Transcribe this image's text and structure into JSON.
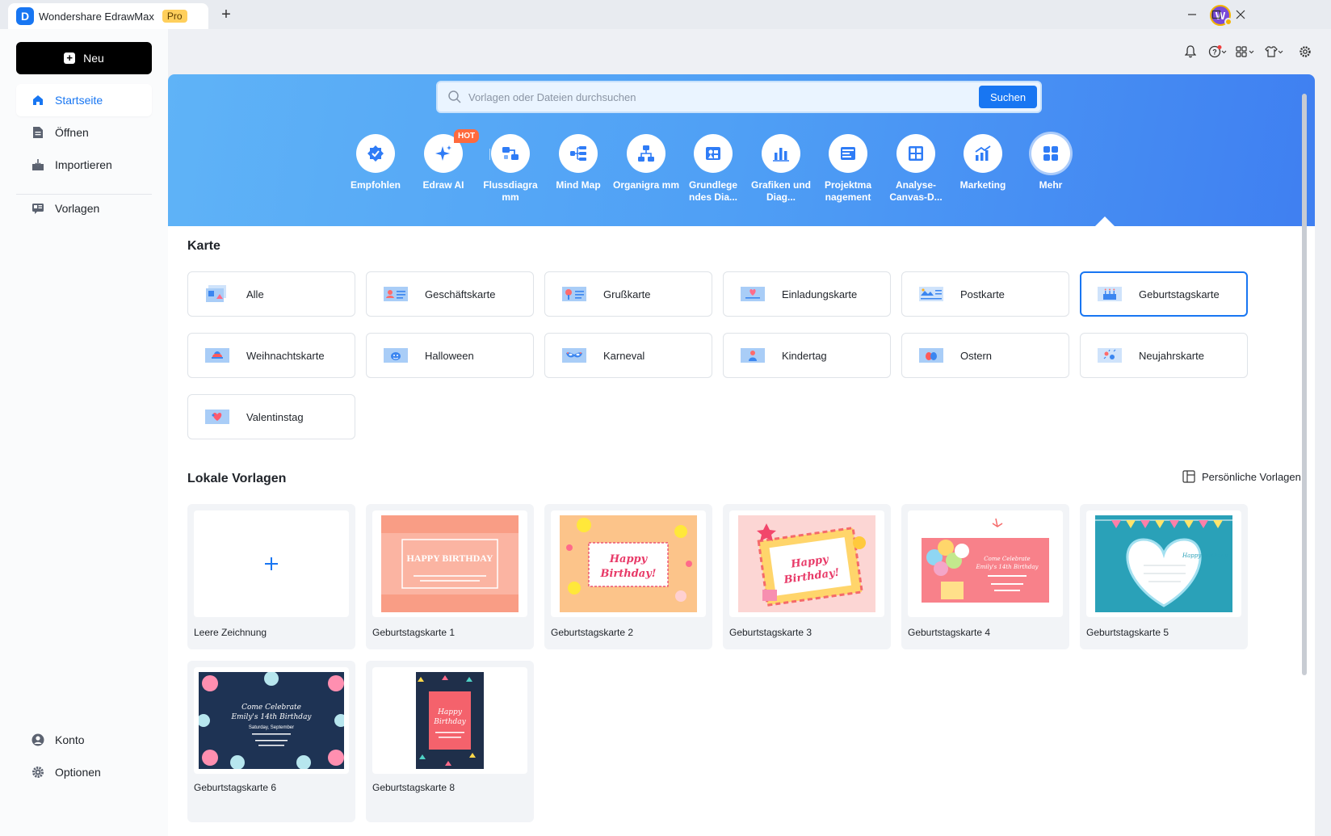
{
  "app": {
    "title": "Wondershare EdrawMax",
    "badge": "Pro",
    "avatar_initial": "W",
    "logo_letter": "D"
  },
  "sidebar": {
    "new_label": "Neu",
    "items": [
      {
        "label": "Startseite",
        "icon": "home-icon",
        "active": true
      },
      {
        "label": "Öffnen",
        "icon": "file-icon"
      },
      {
        "label": "Importieren",
        "icon": "import-icon"
      },
      {
        "label": "Vorlagen",
        "icon": "templates-icon"
      }
    ],
    "bottom_items": [
      {
        "label": "Konto",
        "icon": "account-icon"
      },
      {
        "label": "Optionen",
        "icon": "gear-icon"
      }
    ]
  },
  "search": {
    "placeholder": "Vorlagen oder Dateien durchsuchen",
    "button_label": "Suchen"
  },
  "categories": [
    {
      "label": "Empfohlen",
      "icon": "recommend-icon"
    },
    {
      "label": "Edraw AI",
      "icon": "ai-sparkle-icon",
      "badge": "HOT"
    },
    {
      "label": "Flussdiagra mm",
      "icon": "flowchart-icon"
    },
    {
      "label": "Mind Map",
      "icon": "mindmap-icon"
    },
    {
      "label": "Organigra mm",
      "icon": "orgchart-icon"
    },
    {
      "label": "Grundlege ndes Dia...",
      "icon": "basic-diagram-icon"
    },
    {
      "label": "Grafiken und Diag...",
      "icon": "chart-icon"
    },
    {
      "label": "Projektma nagement",
      "icon": "project-icon"
    },
    {
      "label": "Analyse- Canvas-D...",
      "icon": "canvas-icon"
    },
    {
      "label": "Marketing",
      "icon": "marketing-icon"
    },
    {
      "label": "Mehr",
      "icon": "more-grid-icon",
      "selected": true
    }
  ],
  "karte": {
    "title": "Karte",
    "types": [
      {
        "label": "Alle",
        "icon": "all-cards-icon"
      },
      {
        "label": "Geschäftskarte",
        "icon": "business-card-icon"
      },
      {
        "label": "Grußkarte",
        "icon": "greeting-card-icon"
      },
      {
        "label": "Einladungskarte",
        "icon": "invitation-card-icon"
      },
      {
        "label": "Postkarte",
        "icon": "postcard-icon"
      },
      {
        "label": "Geburtstagskarte",
        "icon": "birthday-card-icon",
        "selected": true
      },
      {
        "label": "Weihnachtskarte",
        "icon": "christmas-card-icon"
      },
      {
        "label": "Halloween",
        "icon": "halloween-card-icon"
      },
      {
        "label": "Karneval",
        "icon": "carnival-card-icon"
      },
      {
        "label": "Kindertag",
        "icon": "childrens-day-icon"
      },
      {
        "label": "Ostern",
        "icon": "easter-card-icon"
      },
      {
        "label": "Neujahrskarte",
        "icon": "new-year-card-icon"
      },
      {
        "label": "Valentinstag",
        "icon": "valentine-card-icon"
      }
    ]
  },
  "local": {
    "title": "Lokale Vorlagen",
    "personal_label": "Persönliche Vorlagen",
    "templates": [
      {
        "label": "Leere Zeichnung",
        "kind": "blank"
      },
      {
        "label": "Geburtstagskarte 1",
        "kind": "t1",
        "text": "HAPPY BIRTHDAY"
      },
      {
        "label": "Geburtstagskarte 2",
        "kind": "t2",
        "text": "Happy Birthday!"
      },
      {
        "label": "Geburtstagskarte 3",
        "kind": "t3",
        "text": "Happy Birthday!"
      },
      {
        "label": "Geburtstagskarte 4",
        "kind": "t4",
        "text": "Come Celebrate Emily's 14th Birthday"
      },
      {
        "label": "Geburtstagskarte 5",
        "kind": "t5",
        "text": "Happy Birthday"
      },
      {
        "label": "Geburtstagskarte 6",
        "kind": "t6",
        "text": "Come Celebrate Emily's 14th Birthday",
        "subtext": "Saturday, September"
      },
      {
        "label": "Geburtstagskarte 8",
        "kind": "t8",
        "text": "Happy Birthday"
      }
    ]
  },
  "colors": {
    "accent": "#1876f2",
    "banner_start": "#5fb3f7",
    "banner_end": "#3f7ff1",
    "hot": "#ff6a3d"
  }
}
